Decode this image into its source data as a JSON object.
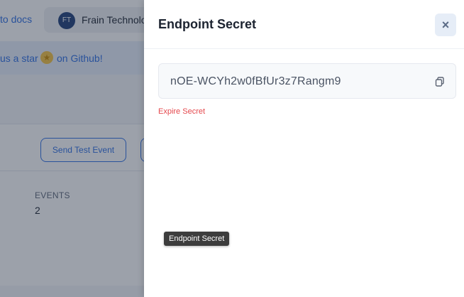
{
  "background": {
    "docs_link": "to docs",
    "org": {
      "avatar_initials": "FT",
      "name": "Frain Technolo"
    },
    "star_bar": {
      "prefix": "us a star",
      "suffix": "on Github!",
      "icon": "star-icon"
    },
    "send_test_event_label": "Send Test Event",
    "events": {
      "label": "EVENTS",
      "value": "2"
    }
  },
  "drawer": {
    "title": "Endpoint Secret",
    "close_icon": "close-icon",
    "secret_value": "nOE-WCYh2w0fBfUr3z7Rangm9",
    "copy_icon": "copy-icon",
    "expire_label": "Expire Secret"
  },
  "tooltip": {
    "text": "Endpoint Secret"
  },
  "colors": {
    "accent": "#2f6fe4",
    "danger": "#e5484d",
    "title": "#1c2330",
    "overlay": "rgba(36,46,66,0.45)"
  }
}
